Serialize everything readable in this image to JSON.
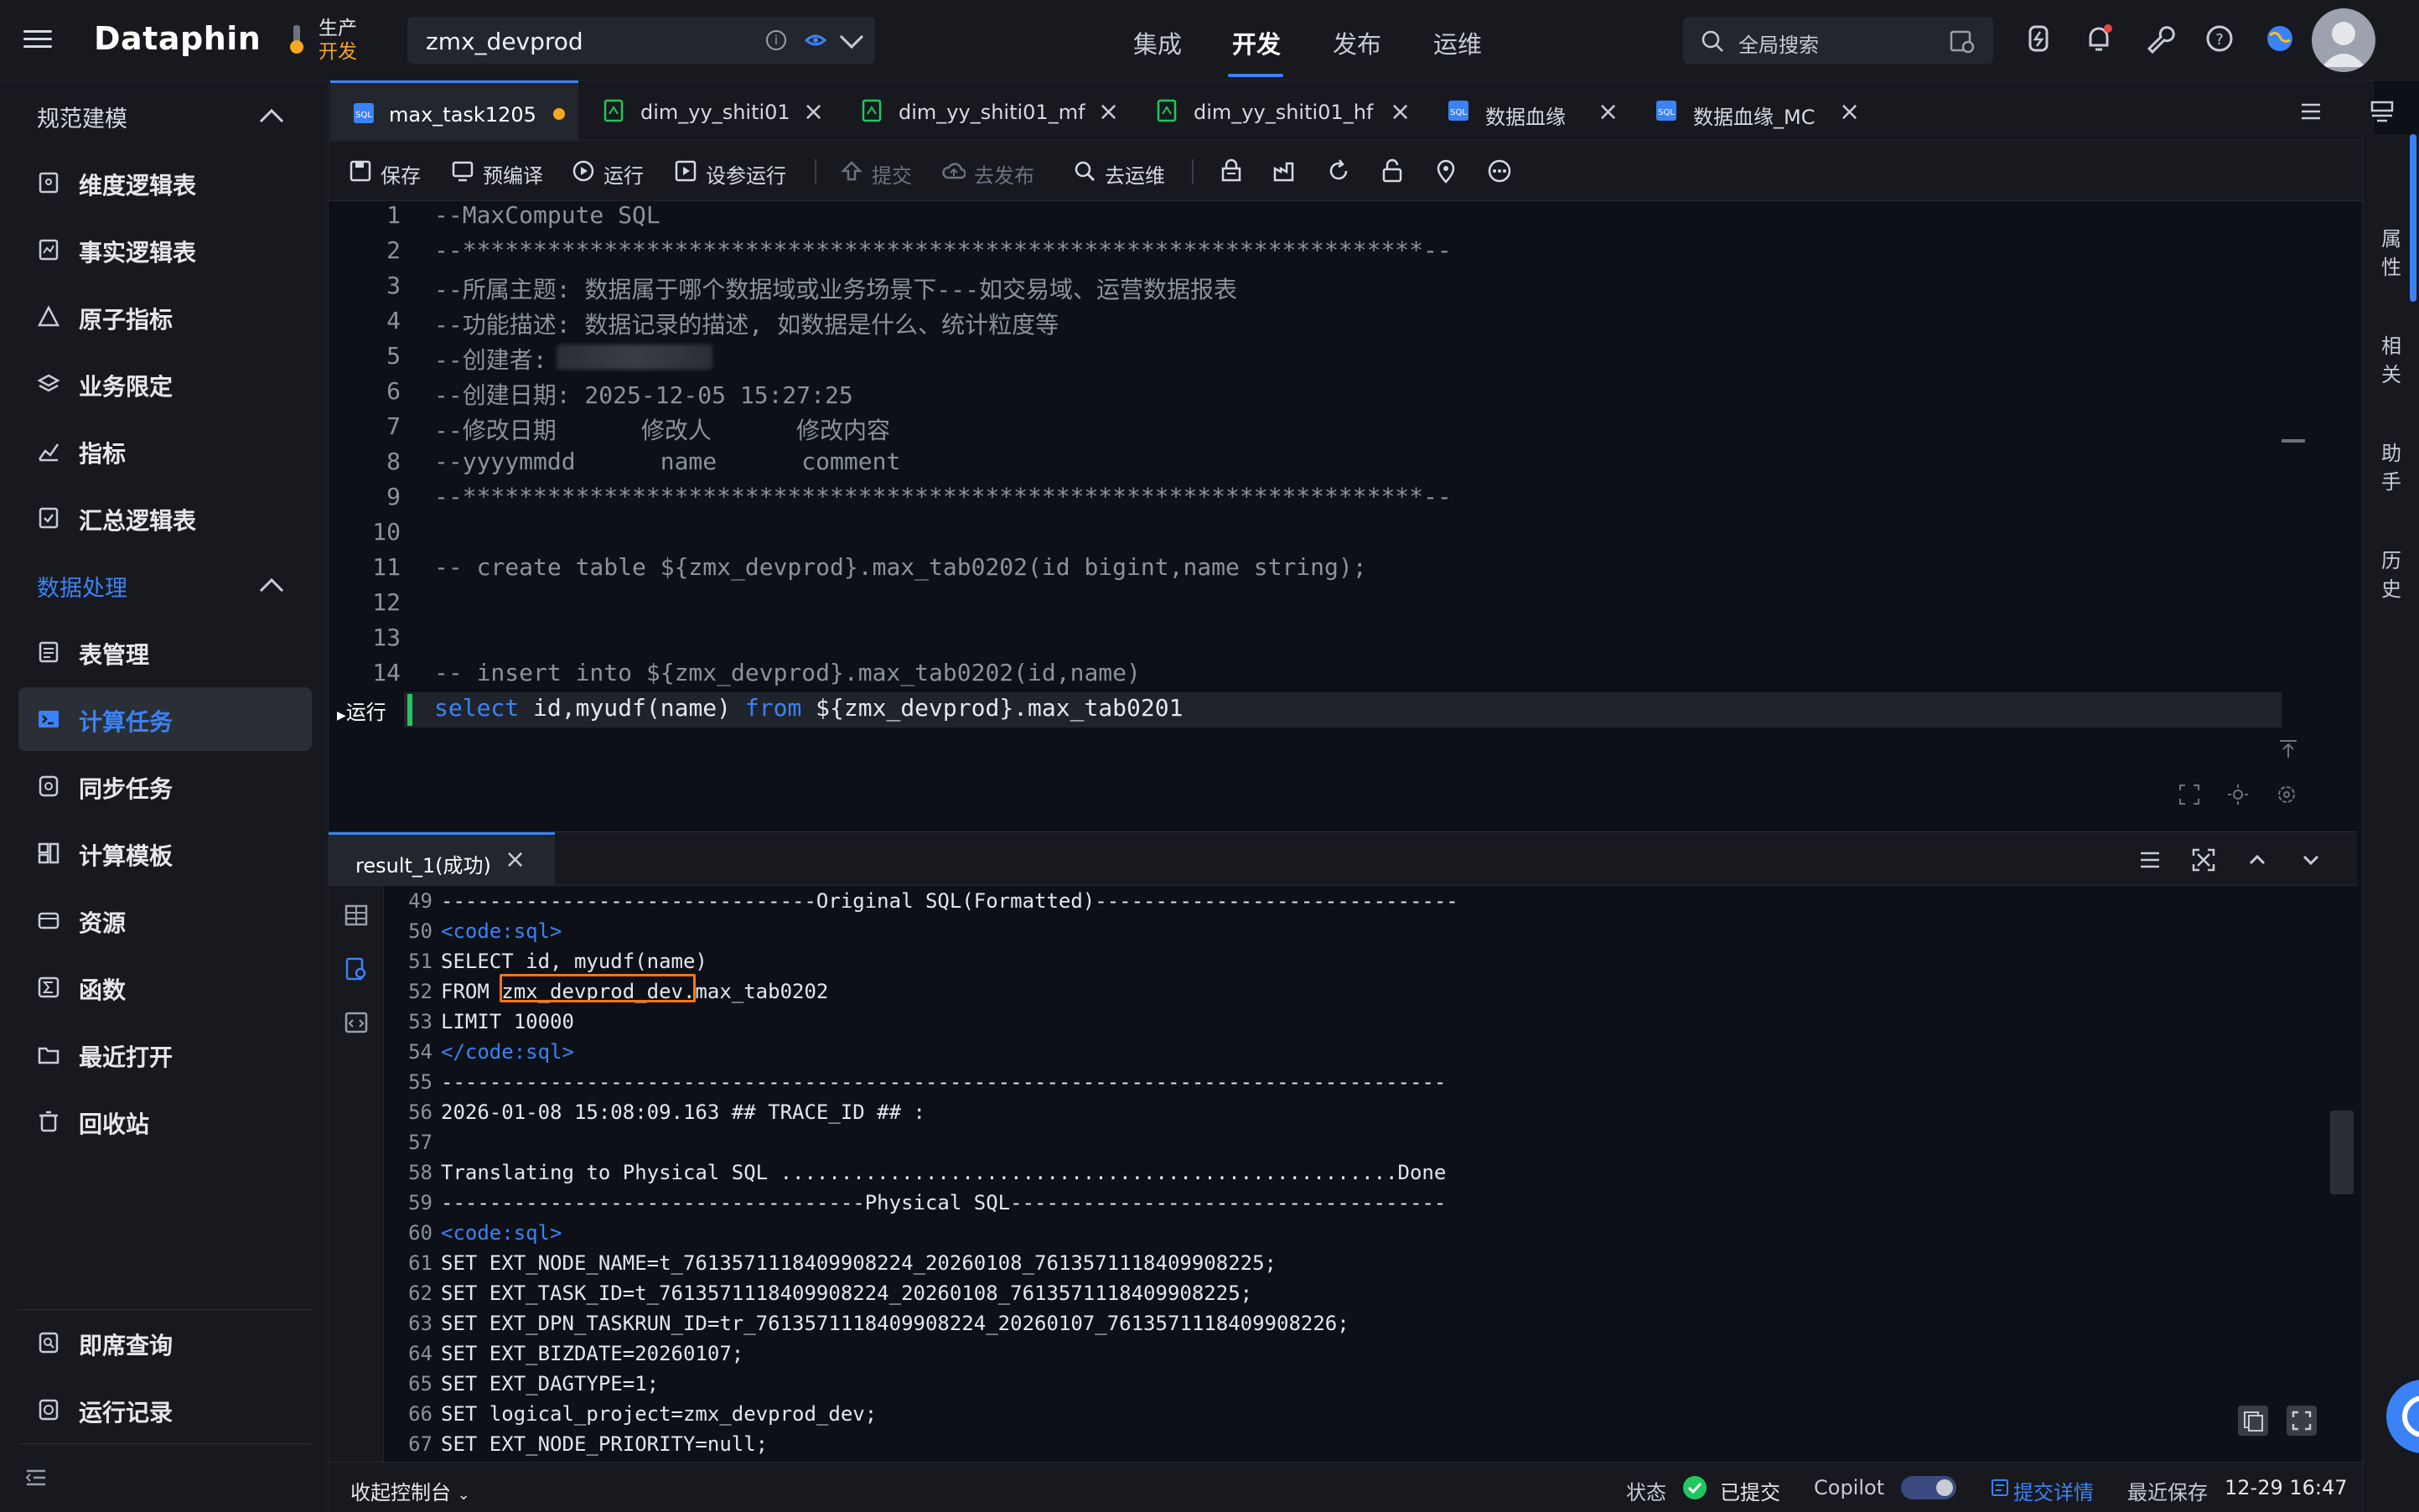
{
  "app": {
    "logo": "Dataphin"
  },
  "env": {
    "line1": "生产",
    "line2": "开发"
  },
  "project": {
    "name": "zmx_devprod"
  },
  "nav": [
    "集成",
    "开发",
    "发布",
    "运维"
  ],
  "search": {
    "placeholder": "全局搜索"
  },
  "sidebar": {
    "section1": "规范建模",
    "items1": [
      "维度逻辑表",
      "事实逻辑表",
      "原子指标",
      "业务限定",
      "指标",
      "汇总逻辑表"
    ],
    "section2": "数据处理",
    "items2": [
      "表管理",
      "计算任务",
      "同步任务",
      "计算模板",
      "资源",
      "函数",
      "最近打开",
      "回收站"
    ],
    "bottom": [
      "即席查询",
      "运行记录"
    ]
  },
  "tabs": [
    {
      "label": "max_task1205",
      "modified": true
    },
    {
      "label": "dim_yy_shiti01"
    },
    {
      "label": "dim_yy_shiti01_mf"
    },
    {
      "label": "dim_yy_shiti01_hf"
    },
    {
      "label": "数据血缘"
    },
    {
      "label": "数据血缘_MC"
    }
  ],
  "toolbar": {
    "save": "保存",
    "precompile": "预编译",
    "run": "运行",
    "param_run": "设参运行",
    "submit": "提交",
    "publish": "去发布",
    "ops": "去运维"
  },
  "editor": {
    "run_label": "运行",
    "lines": [
      "--MaxCompute SQL",
      "--********************************************************************--",
      "--所属主题: 数据属于哪个数据域或业务场景下---如交易域、运营数据报表",
      "--功能描述: 数据记录的描述, 如数据是什么、统计粒度等",
      "--创建者: ",
      "--创建日期: 2025-12-05 15:27:25",
      "--修改日期      修改人      修改内容",
      "--yyyymmdd      name      comment",
      "--********************************************************************--",
      "",
      "-- create table ${zmx_devprod}.max_tab0202(id bigint,name string);",
      "",
      "",
      "-- insert into ${zmx_devprod}.max_tab0202(id,name)"
    ],
    "line15": {
      "kw1": "select",
      "mid": " id,myudf(name) ",
      "kw2": "from",
      "rest": " ${zmx_devprod}.max_tab0201"
    },
    "line_numbers": [
      "1",
      "2",
      "3",
      "4",
      "5",
      "6",
      "7",
      "8",
      "9",
      "10",
      "11",
      "12",
      "13",
      "14"
    ]
  },
  "rightbar": [
    "属性",
    "相关",
    "助手",
    "历史"
  ],
  "result": {
    "tab": "result_1(成功)",
    "lines": [
      {
        "n": "49",
        "t": "-------------------------------Original SQL(Formatted)------------------------------"
      },
      {
        "n": "50",
        "t": "<code:sql>"
      },
      {
        "n": "51",
        "t": "SELECT id, myudf(name)"
      },
      {
        "n": "52",
        "t": "FROM zmx_devprod_dev.max_tab0202"
      },
      {
        "n": "53",
        "t": "LIMIT 10000"
      },
      {
        "n": "54",
        "t": "</code:sql>"
      },
      {
        "n": "55",
        "t": "-----------------------------------------------------------------------------------"
      },
      {
        "n": "56",
        "t": "2026-01-08 15:08:09.163 ## TRACE_ID ## :"
      },
      {
        "n": "57",
        "t": ""
      },
      {
        "n": "58",
        "t": "Translating to Physical SQL ...................................................Done"
      },
      {
        "n": "59",
        "t": "-----------------------------------Physical SQL------------------------------------"
      },
      {
        "n": "60",
        "t": "<code:sql>"
      },
      {
        "n": "61",
        "t": "SET EXT_NODE_NAME=t_7613571118409908224_20260108_7613571118409908225;"
      },
      {
        "n": "62",
        "t": "SET EXT_TASK_ID=t_7613571118409908224_20260108_7613571118409908225;"
      },
      {
        "n": "63",
        "t": "SET EXT_DPN_TASKRUN_ID=tr_7613571118409908224_20260107_7613571118409908226;"
      },
      {
        "n": "64",
        "t": "SET EXT_BIZDATE=20260107;"
      },
      {
        "n": "65",
        "t": "SET EXT_DAGTYPE=1;"
      },
      {
        "n": "66",
        "t": "SET logical_project=zmx_devprod_dev;"
      },
      {
        "n": "67",
        "t": "SET EXT_NODE_PRIORITY=null;"
      }
    ]
  },
  "status": {
    "collapse": "收起控制台",
    "state_label": "状态",
    "state_value": "已提交",
    "copilot": "Copilot",
    "submit_detail": "提交详情",
    "last_save_label": "最近保存",
    "last_save_value": "12-29 16:47"
  },
  "colors": {
    "accent": "#3b82f6",
    "modified": "#f5a623",
    "success": "#22c55e",
    "highlight": "#f97316"
  }
}
